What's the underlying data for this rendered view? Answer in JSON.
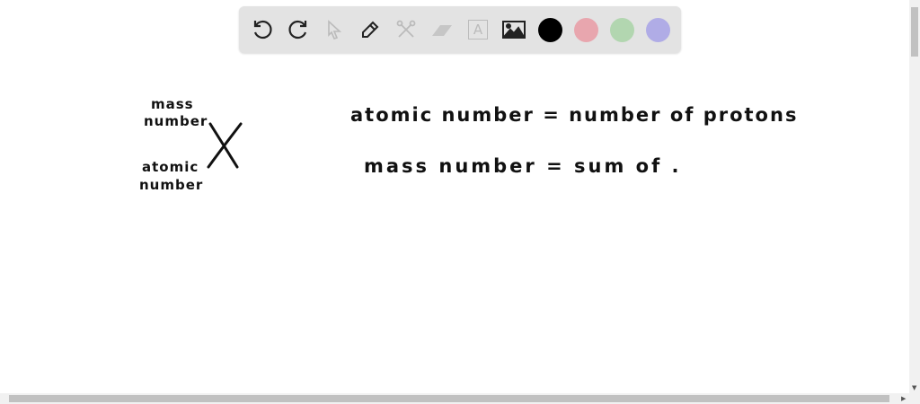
{
  "toolbar": {
    "tools": [
      "undo-icon",
      "redo-icon",
      "select-icon",
      "pen-icon",
      "tools-icon",
      "eraser-icon",
      "text-icon",
      "image-icon"
    ],
    "text_tool_glyph": "A",
    "colors": {
      "black": "#000000",
      "pink": "#e8a6ae",
      "green": "#b2d6b0",
      "purple": "#b0ace6"
    }
  },
  "canvas": {
    "diagram": {
      "mass_label_line1": "mass",
      "mass_label_line2": "number",
      "symbol": "X",
      "atomic_label_line1": "atomic",
      "atomic_label_line2": "number"
    },
    "line1": "atomic number = number of protons",
    "line2": "mass number = sum of ."
  }
}
